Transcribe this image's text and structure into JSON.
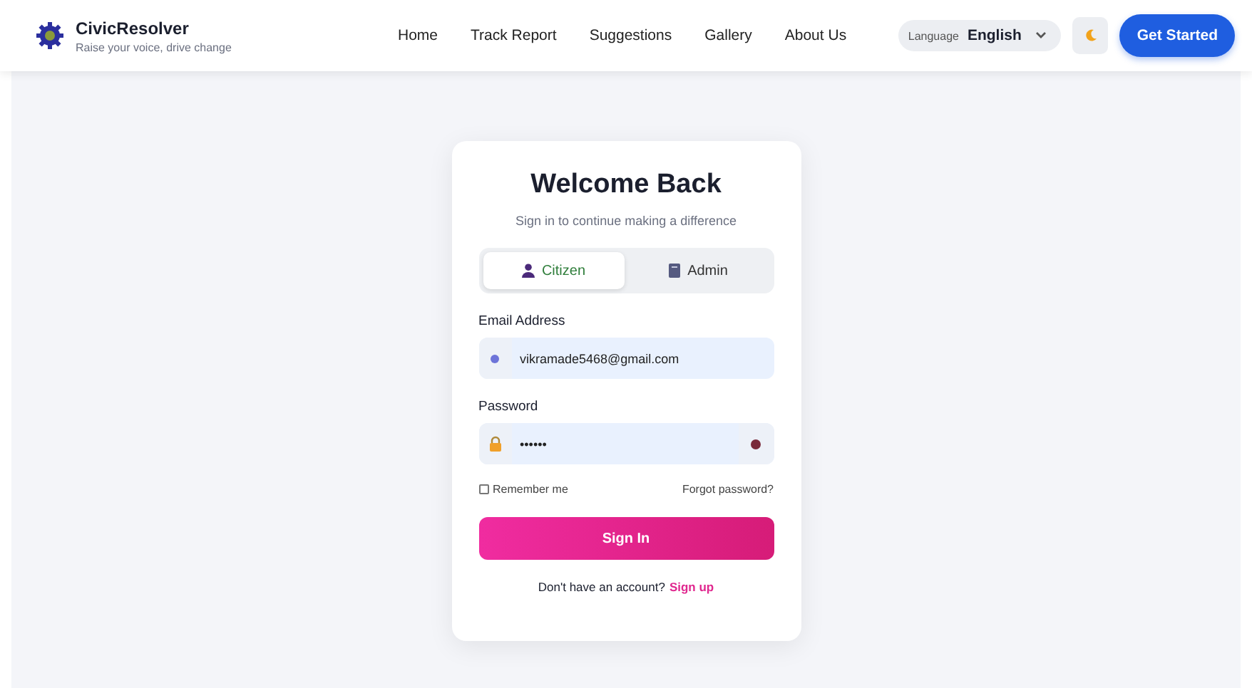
{
  "brand": {
    "name": "CivicResolver",
    "tagline": "Raise your voice, drive change"
  },
  "nav": [
    {
      "label": "Home"
    },
    {
      "label": "Track Report"
    },
    {
      "label": "Suggestions"
    },
    {
      "label": "Gallery"
    },
    {
      "label": "About Us"
    }
  ],
  "language": {
    "label": "Language",
    "value": "English"
  },
  "cta": "Get Started",
  "login": {
    "title": "Welcome Back",
    "subtitle": "Sign in to continue making a difference",
    "roles": [
      {
        "label": "Citizen",
        "kind": "person",
        "selected": true
      },
      {
        "label": "Admin",
        "kind": "badge",
        "selected": false
      }
    ],
    "email": {
      "label": "Email Address",
      "value": "vikramade5468@gmail.com"
    },
    "password": {
      "label": "Password",
      "value": "••••••"
    },
    "remember": {
      "label": "Remember me",
      "checked": false
    },
    "forgot": "Forgot password?",
    "submit": "Sign In",
    "signup_prompt": "Don't have an account?",
    "signup_link": "Sign up"
  }
}
